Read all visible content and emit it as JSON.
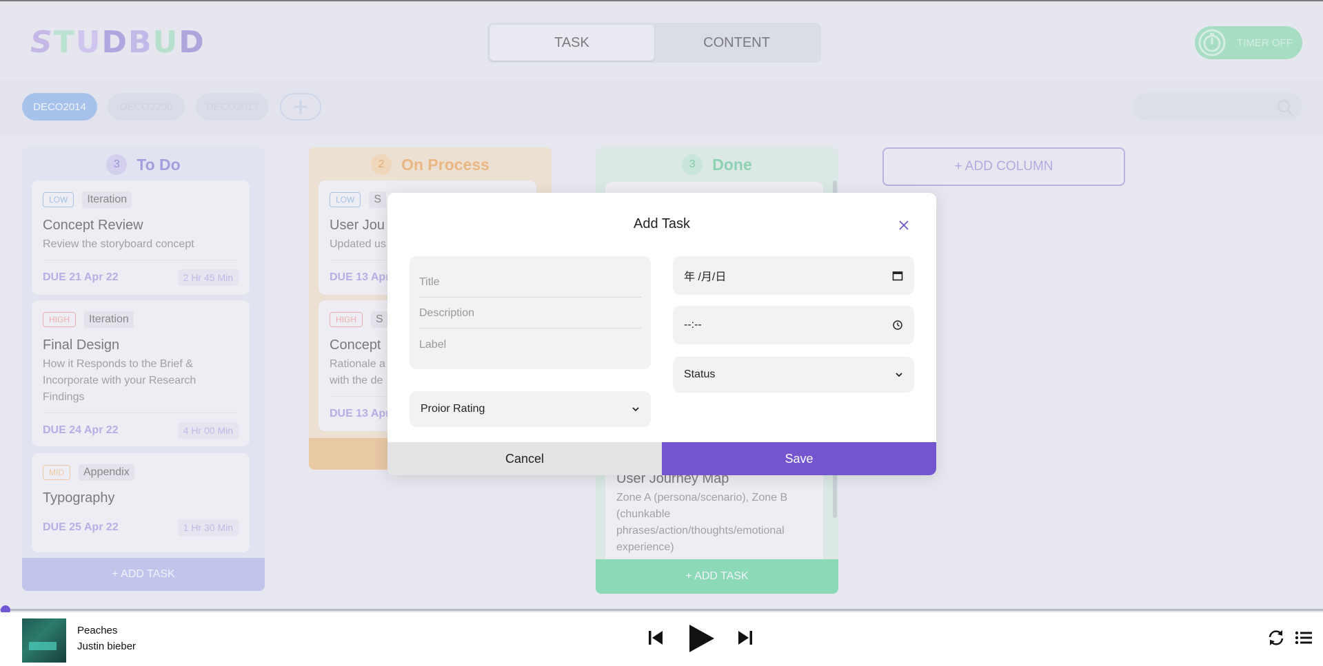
{
  "header": {
    "logo_text": "STUDBUD",
    "tabs": [
      {
        "label": "TASK",
        "active": true
      },
      {
        "label": "CONTENT",
        "active": false
      }
    ],
    "timer_label": "TIMER OFF"
  },
  "courses": {
    "items": [
      "DECO2014",
      "DECO2200",
      "DECO2017"
    ],
    "active": "DECO2014"
  },
  "board": {
    "columns": [
      {
        "title": "To Do",
        "count": "3",
        "add_label": "+ ADD TASK",
        "cards": [
          {
            "priority": "LOW",
            "label": "Iteration",
            "title": "Concept Review",
            "desc": "Review the storyboard concept",
            "due": "DUE 21 Apr 22",
            "duration": "2 Hr 45 Min"
          },
          {
            "priority": "HIGH",
            "label": "Iteration",
            "title": "Final Design",
            "desc": "How it Responds to the Brief & Incorporate with your Research Findings",
            "due": "DUE 24 Apr 22",
            "duration": "4 Hr 00 Min"
          },
          {
            "priority": "MID",
            "label": "Appendix",
            "title": "Typography",
            "desc": "",
            "due": "DUE 25 Apr 22",
            "duration": "1 Hr 30 Min"
          }
        ]
      },
      {
        "title": "On Process",
        "count": "2",
        "add_label": "",
        "cards": [
          {
            "priority": "LOW",
            "label": "S",
            "title": "User Jou",
            "desc": "Updated us",
            "due": "DUE 13 Apr",
            "duration": ""
          },
          {
            "priority": "HIGH",
            "label": "S",
            "title": "Concept",
            "desc": "Rationale a with the de",
            "due": "DUE 13 Apr",
            "duration": ""
          }
        ]
      },
      {
        "title": "Done",
        "count": "3",
        "add_label": "+ ADD TASK",
        "cards": [
          {
            "title": "User Journey Map",
            "desc": "Zone A (persona/scenario), Zone B (chunkable phrases/action/thoughts/emotional experience)"
          }
        ]
      }
    ],
    "add_column_label": "+ ADD COLUMN"
  },
  "modal": {
    "title": "Add Task",
    "title_placeholder": "Title",
    "description_placeholder": "Description",
    "label_placeholder": "Label",
    "date_value": "年 /月/日",
    "time_value": "--:--",
    "status_value": "Status",
    "prior_value": "Proior Rating",
    "cancel_label": "Cancel",
    "save_label": "Save"
  },
  "player": {
    "song": "Peaches",
    "artist": "Justin bieber",
    "progress": 0
  },
  "colors": {
    "accent": "#7255cf",
    "todo": "#8e84d6",
    "process": "#eaa45d",
    "done": "#6cc99b"
  }
}
